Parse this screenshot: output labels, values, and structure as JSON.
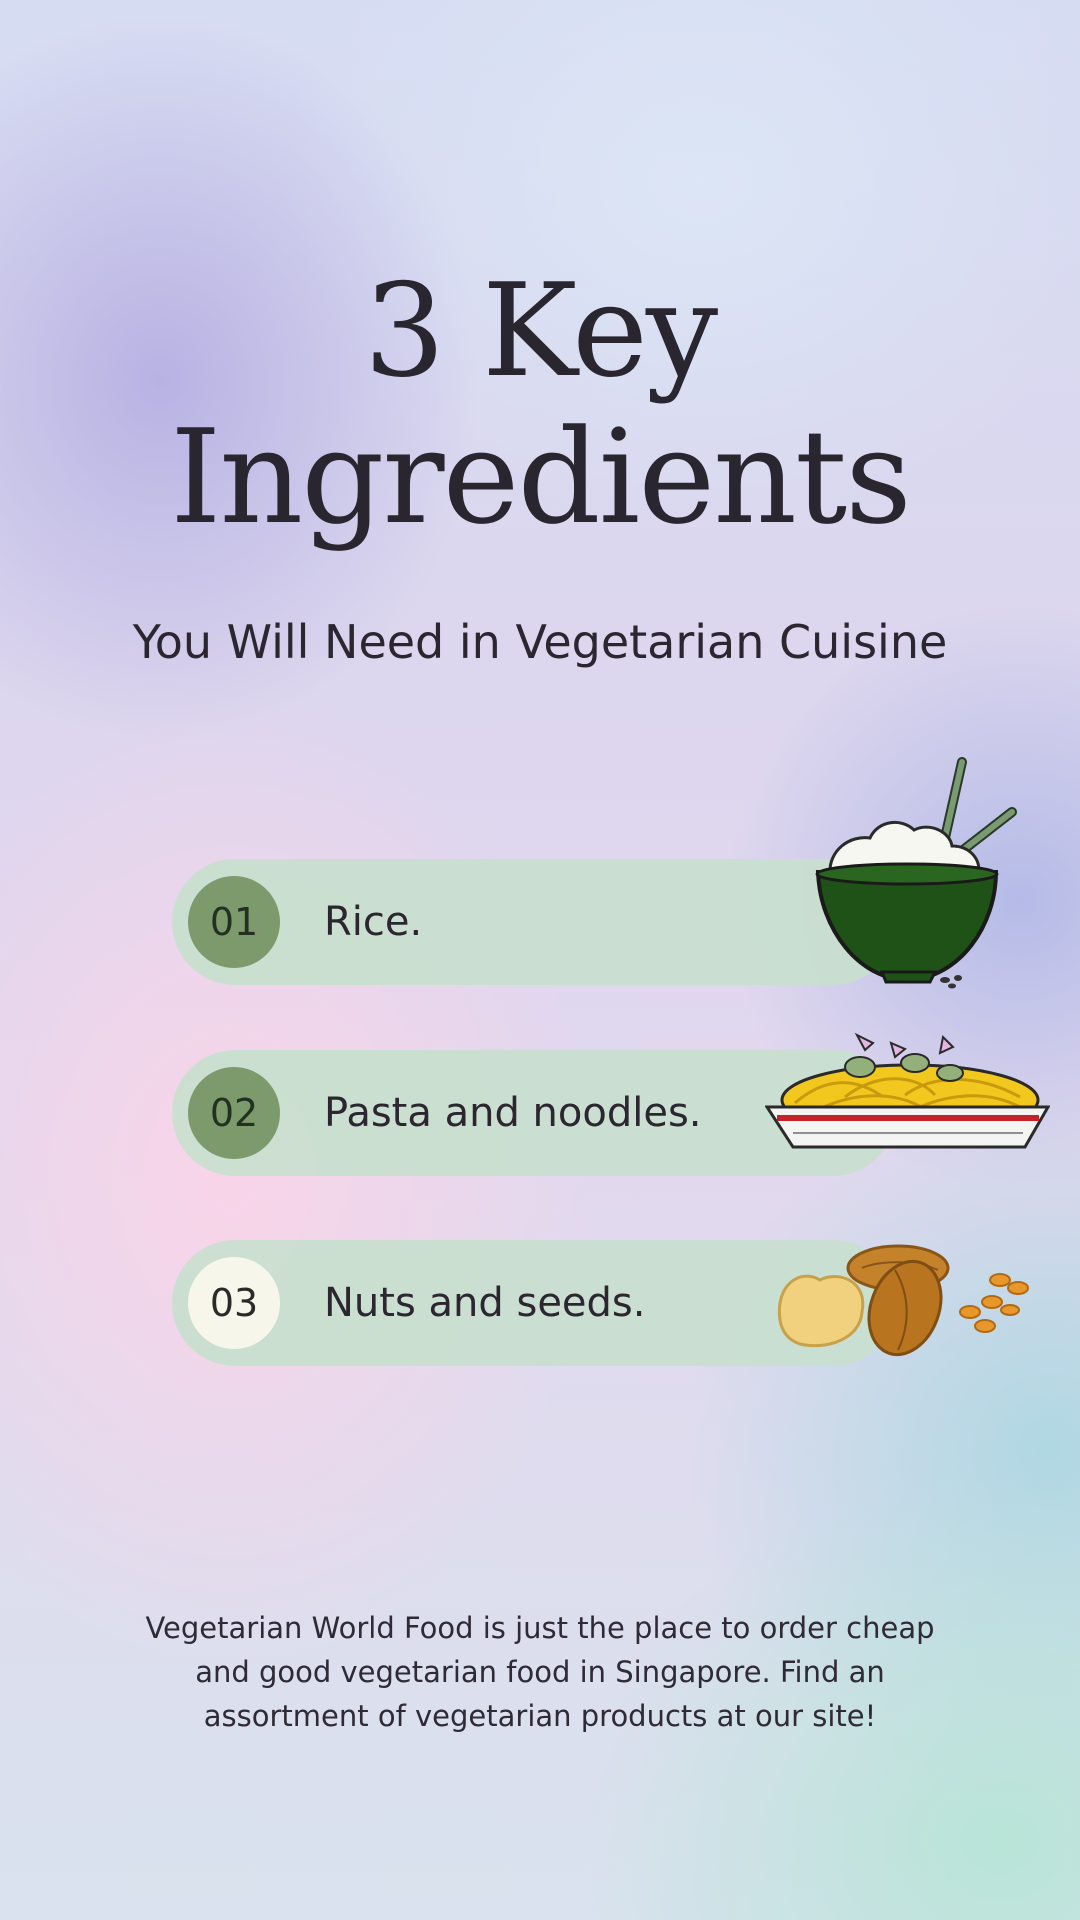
{
  "title": {
    "line1": "3 Key",
    "line2": "Ingredients"
  },
  "subtitle": "You Will Need in Vegetarian Cuisine",
  "items": [
    {
      "number": "01",
      "label": "Rice.",
      "icon": "rice-bowl-icon"
    },
    {
      "number": "02",
      "label": "Pasta and noodles.",
      "icon": "pasta-plate-icon"
    },
    {
      "number": "03",
      "label": "Nuts and seeds.",
      "icon": "nuts-icon"
    }
  ],
  "footer": "Vegetarian World Food is just the place to order cheap and good vegetarian food in Singapore. Find an assortment of vegetarian products at our site!",
  "colors": {
    "pill": "#c8e0ce",
    "badge": "#7c9a6c",
    "badge_light": "#f6f7ea",
    "text": "#2b2630"
  }
}
